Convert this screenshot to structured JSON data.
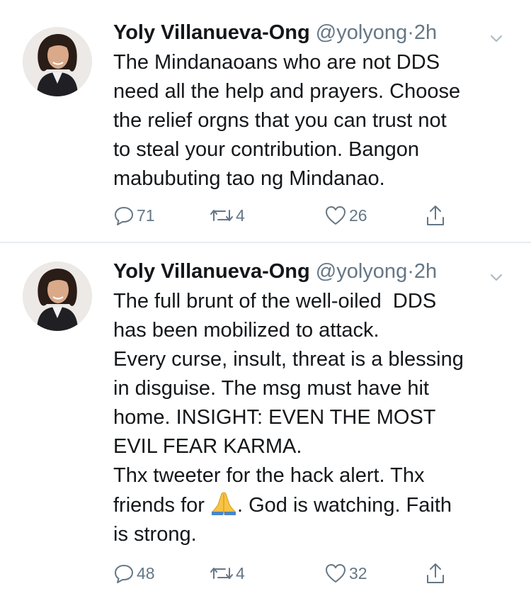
{
  "colors": {
    "text": "#14171a",
    "secondary": "#657786",
    "divider": "#e6ecf0",
    "emoji": "#f7c344"
  },
  "tweets": [
    {
      "display_name": "Yoly Villanueva-Ong",
      "handle": "@yolyong",
      "separator": "·",
      "time": "2h",
      "body": "The Mindanaoans who are not DDS\nneed all the help and prayers. Choose\nthe relief orgns that you can trust not\nto steal your contribution. Bangon\nmabubuting tao ng Mindanao.",
      "replies": "71",
      "retweets": "4",
      "likes": "26"
    },
    {
      "display_name": "Yoly Villanueva-Ong",
      "handle": "@yolyong",
      "separator": "·",
      "time": "2h",
      "body_part1": "The full brunt of the well-oiled  DDS\nhas been mobilized to attack.\nEvery curse, insult, threat is a blessing\nin disguise. The msg must have hit\nhome. INSIGHT: EVEN THE MOST\nEVIL FEAR KARMA.\nThx tweeter for the hack alert. Thx\nfriends for ",
      "emoji_icon": "folded-hands-emoji",
      "body_part2": ". God is watching. Faith\nis strong.",
      "replies": "48",
      "retweets": "4",
      "likes": "32"
    }
  ]
}
